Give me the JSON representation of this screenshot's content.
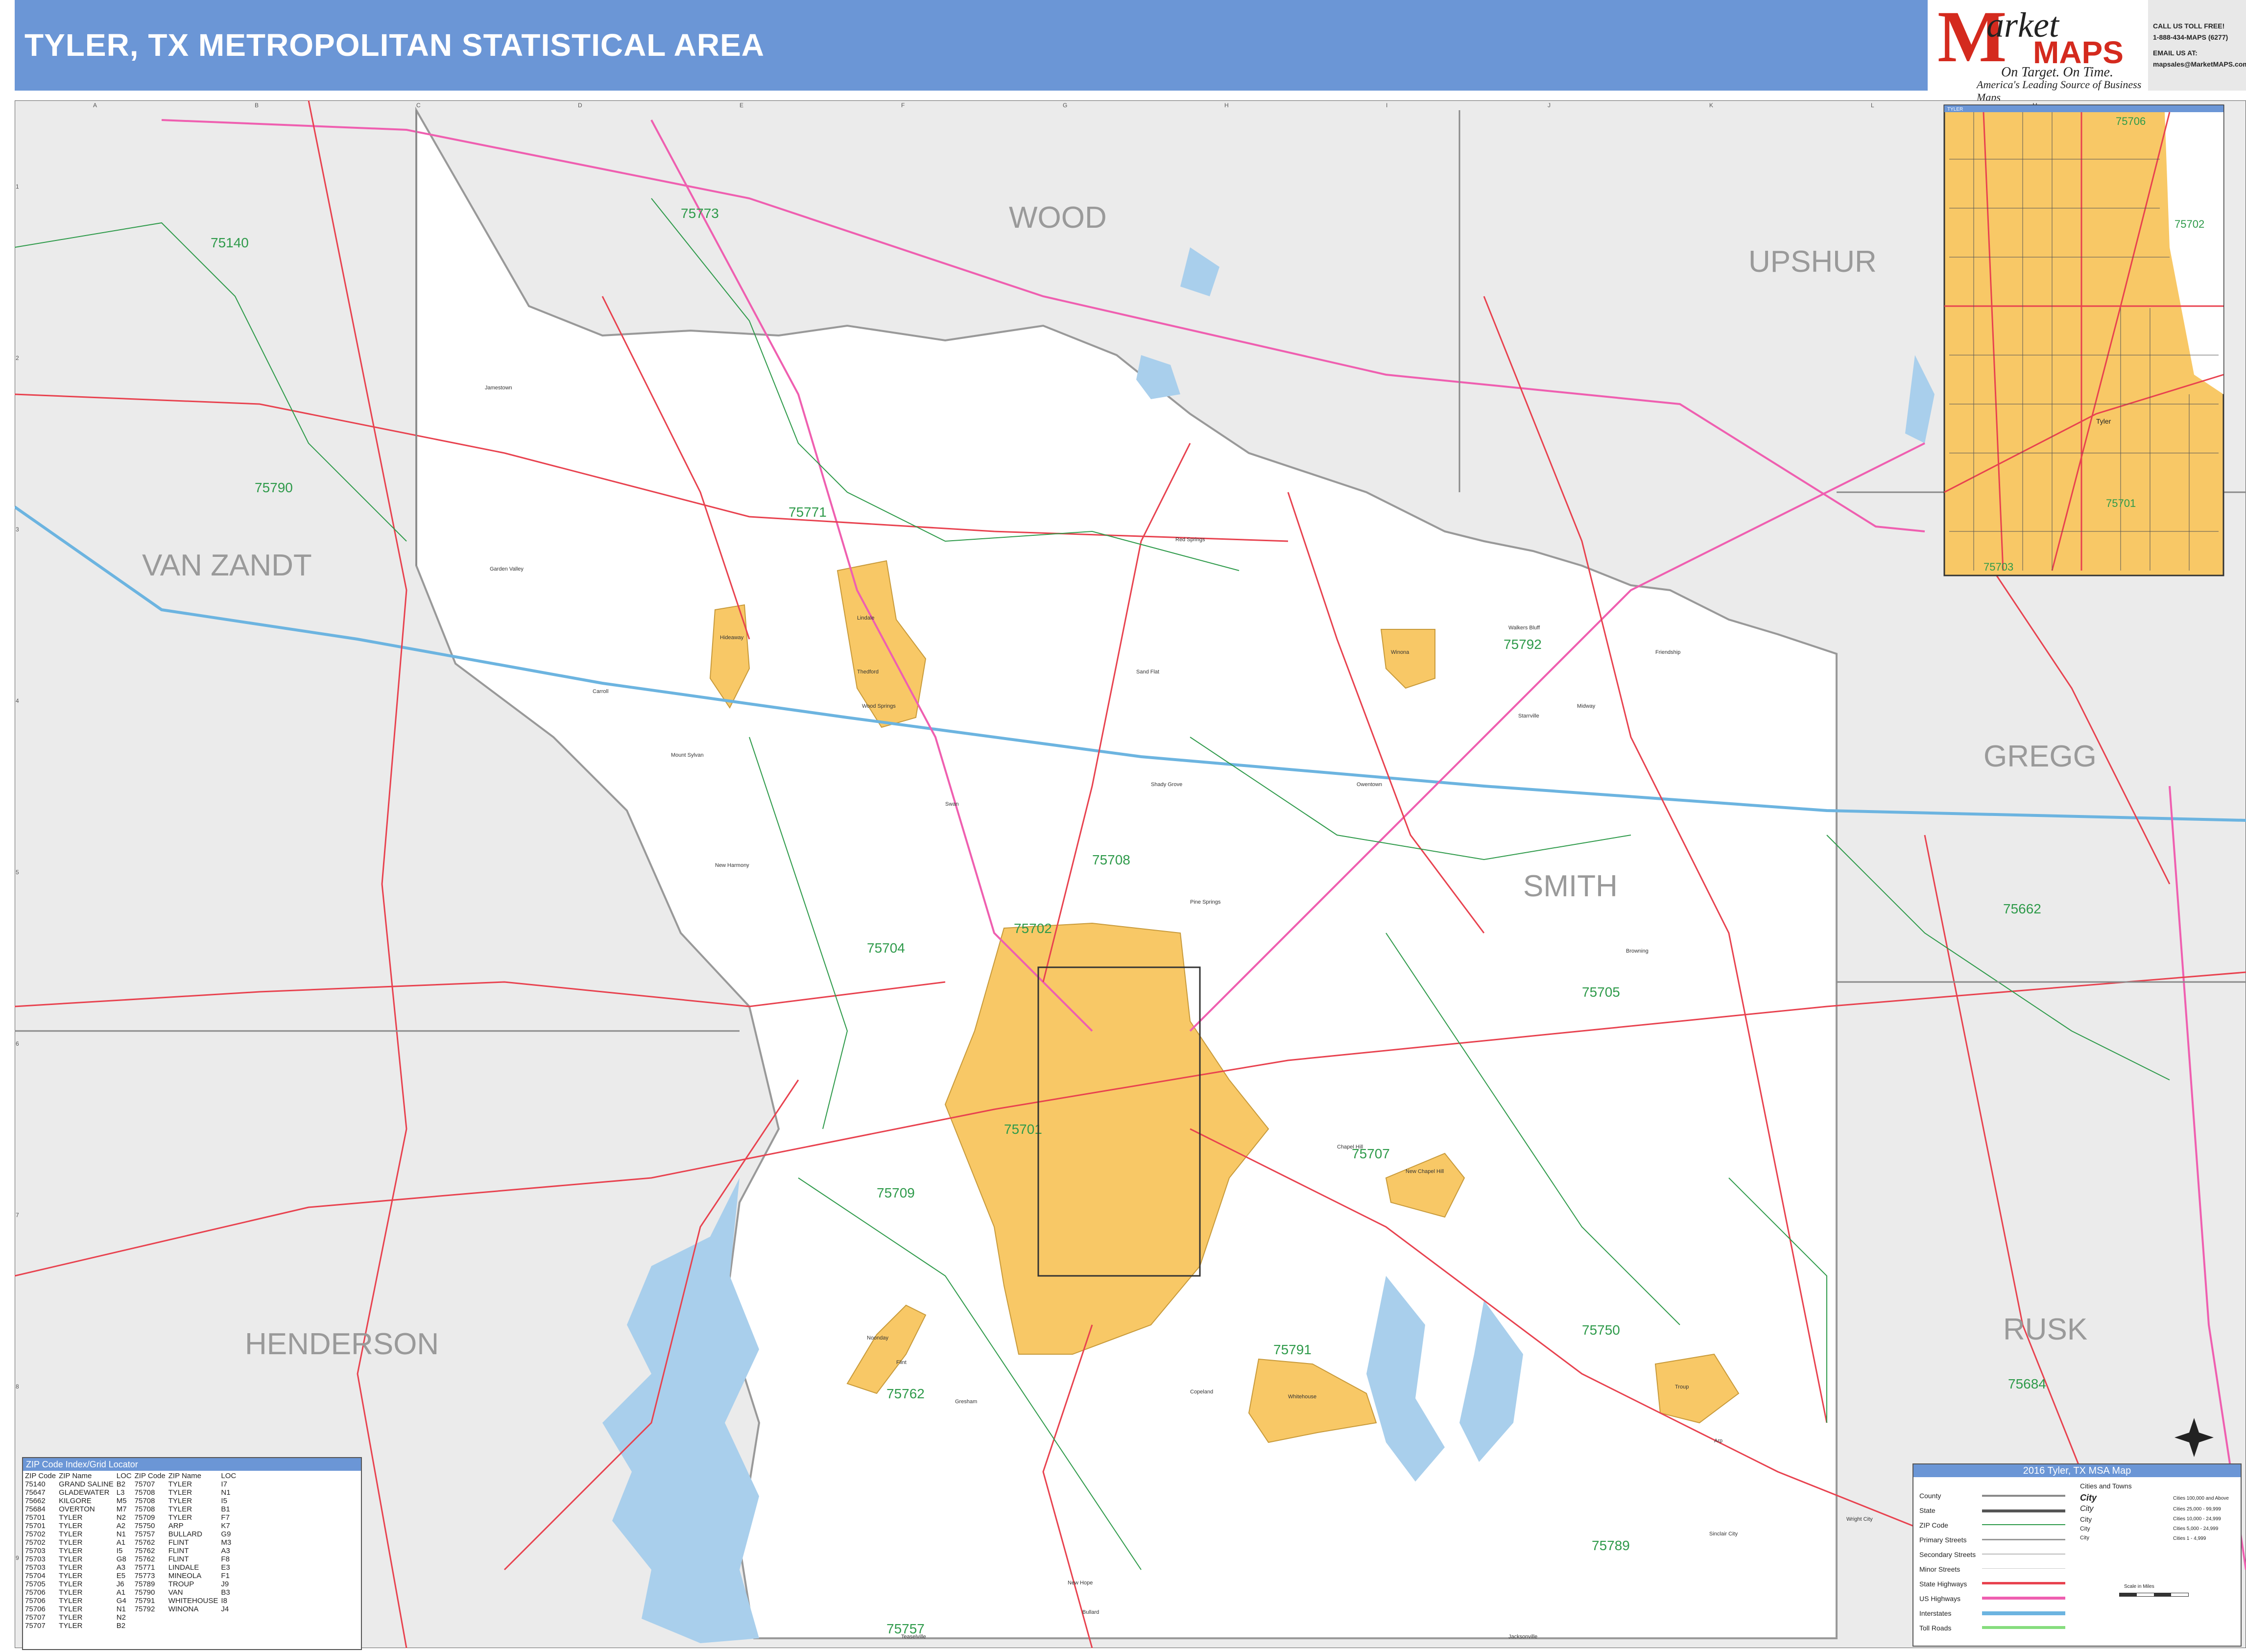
{
  "header": {
    "title": "TYLER, TX METROPOLITAN STATISTICAL AREA"
  },
  "logo": {
    "brand_line1": "arket",
    "brand_line2": "MAPS",
    "tagline1": "On Target.  On Time.",
    "tagline2": "America's Leading Source of  Business Maps"
  },
  "contact": {
    "line1": "CALL  US  TOLL  FREE!",
    "line2": "1-888-434-MAPS  (6277)",
    "line3": "EMAIL  US  AT:",
    "line4": "mapsales@MarketMAPS.com"
  },
  "grid": {
    "columns": [
      "A",
      "B",
      "C",
      "D",
      "E",
      "F",
      "G",
      "H",
      "I",
      "J",
      "K",
      "L",
      "M"
    ],
    "rows": [
      "1",
      "2",
      "3",
      "4",
      "5",
      "6",
      "7",
      "8",
      "9"
    ]
  },
  "counties": {
    "wood": "WOOD",
    "upshur": "UPSHUR",
    "van_zandt": "VAN ZANDT",
    "gregg": "GREGG",
    "smith": "SMITH",
    "henderson": "HENDERSON",
    "rusk": "RUSK"
  },
  "zips": {
    "z75140": "75140",
    "z75773": "75773",
    "z75790": "75790",
    "z75771": "75771",
    "z75792": "75792",
    "z75708": "75708",
    "z75662": "75662",
    "z75704": "75704",
    "z75705": "75705",
    "z75702": "75702",
    "z75701": "75701",
    "z75703": "75703",
    "z75709": "75709",
    "z75707": "75707",
    "z75762": "75762",
    "z75791": "75791",
    "z75750": "75750",
    "z75684": "75684",
    "z75789": "75789",
    "z75757": "75757"
  },
  "inset": {
    "label": "TYLER",
    "zip_75706": "75706",
    "zip_75702": "75702",
    "zip_75701": "75701",
    "zip_75703": "75703",
    "town": "Tyler"
  },
  "towns": {
    "lindale": "Lindale",
    "hideaway": "Hideaway",
    "winona": "Winona",
    "new_chapel_hill": "New Chapel Hill",
    "whitehouse": "Whitehouse",
    "troup": "Troup",
    "noonday": "Noonday",
    "bullard": "Bullard",
    "chapel_hill": "Chapel Hill",
    "red_springs": "Red Springs",
    "wood_springs": "Wood Springs",
    "sand_flat": "Sand Flat",
    "mount_sylvan": "Mount Sylvan",
    "new_harmony": "New Harmony",
    "swan": "Swan",
    "owentown": "Owentown",
    "starrville": "Starrville",
    "friendship": "Friendship",
    "midway": "Midway",
    "walkers_bluff": "Walkers Bluff",
    "arp": "Arp",
    "jamestown": "Jamestown",
    "garden_valley": "Garden Valley",
    "new_hope": "New Hope",
    "copeland": "Copeland",
    "gresham": "Gresham",
    "flint": "Flint",
    "teaselville": "Teaselville",
    "jacksonville": "Jacksonville",
    "sinclair_city": "Sinclair City",
    "wright_city": "Wright City",
    "shady_grove": "Shady Grove",
    "carroll": "Carroll",
    "thedford": "Thedford",
    "pine_springs": "Pine Springs",
    "browning": "Browning"
  },
  "zip_index": {
    "title": "ZIP Code Index/Grid Locator",
    "headers": [
      "ZIP Code",
      "ZIP Name",
      "LOC",
      "ZIP Code",
      "ZIP Name",
      "LOC"
    ],
    "rows": [
      [
        "75140",
        "GRAND SALINE",
        "B2",
        "75707",
        "TYLER",
        "I7"
      ],
      [
        "75647",
        "GLADEWATER",
        "L3",
        "75708",
        "TYLER",
        "N1"
      ],
      [
        "75662",
        "KILGORE",
        "M5",
        "75708",
        "TYLER",
        "I5"
      ],
      [
        "75684",
        "OVERTON",
        "M7",
        "75708",
        "TYLER",
        "B1"
      ],
      [
        "75701",
        "TYLER",
        "N2",
        "75709",
        "TYLER",
        "F7"
      ],
      [
        "75701",
        "TYLER",
        "A2",
        "75750",
        "ARP",
        "K7"
      ],
      [
        "75702",
        "TYLER",
        "N1",
        "75757",
        "BULLARD",
        "G9"
      ],
      [
        "75702",
        "TYLER",
        "A1",
        "75762",
        "FLINT",
        "M3"
      ],
      [
        "75703",
        "TYLER",
        "I5",
        "75762",
        "FLINT",
        "A3"
      ],
      [
        "75703",
        "TYLER",
        "G8",
        "75762",
        "FLINT",
        "F8"
      ],
      [
        "75703",
        "TYLER",
        "A3",
        "75771",
        "LINDALE",
        "E3"
      ],
      [
        "75704",
        "TYLER",
        "E5",
        "75773",
        "MINEOLA",
        "F1"
      ],
      [
        "75705",
        "TYLER",
        "J6",
        "75789",
        "TROUP",
        "J9"
      ],
      [
        "75706",
        "TYLER",
        "A1",
        "75790",
        "VAN",
        "B3"
      ],
      [
        "75706",
        "TYLER",
        "G4",
        "75791",
        "WHITEHOUSE",
        "I8"
      ],
      [
        "75706",
        "TYLER",
        "N1",
        "75792",
        "WINONA",
        "J4"
      ],
      [
        "75707",
        "TYLER",
        "N2",
        "",
        "",
        ""
      ],
      [
        "75707",
        "TYLER",
        "B2",
        "",
        "",
        ""
      ]
    ]
  },
  "legend": {
    "title": "2016 Tyler, TX MSA Map",
    "cities_title": "Cities and Towns",
    "items": [
      "County",
      "State",
      "ZIP Code",
      "Primary Streets",
      "Secondary Streets",
      "Minor Streets",
      "State Highways",
      "US Highways",
      "Interstates",
      "Toll Roads"
    ],
    "city_levels": [
      "City",
      "City",
      "City",
      "City",
      "City"
    ],
    "populations": [
      "Cities 100,000 and Above",
      "Cities 25,000 - 99,999",
      "Cities 10,000 - 24,999",
      "Cities 5,000 - 24,999",
      "Cities 1 - 4,999"
    ],
    "scale": "Scale in Miles",
    "colors": {
      "state_hwy": "#e8424f",
      "us_hwy": "#ef5fb0",
      "interstate": "#6cb4e0",
      "toll": "#86dd7e",
      "zip": "#2e9a4a",
      "county": "#8a8a8a",
      "city_fill": "#f8c866"
    }
  }
}
